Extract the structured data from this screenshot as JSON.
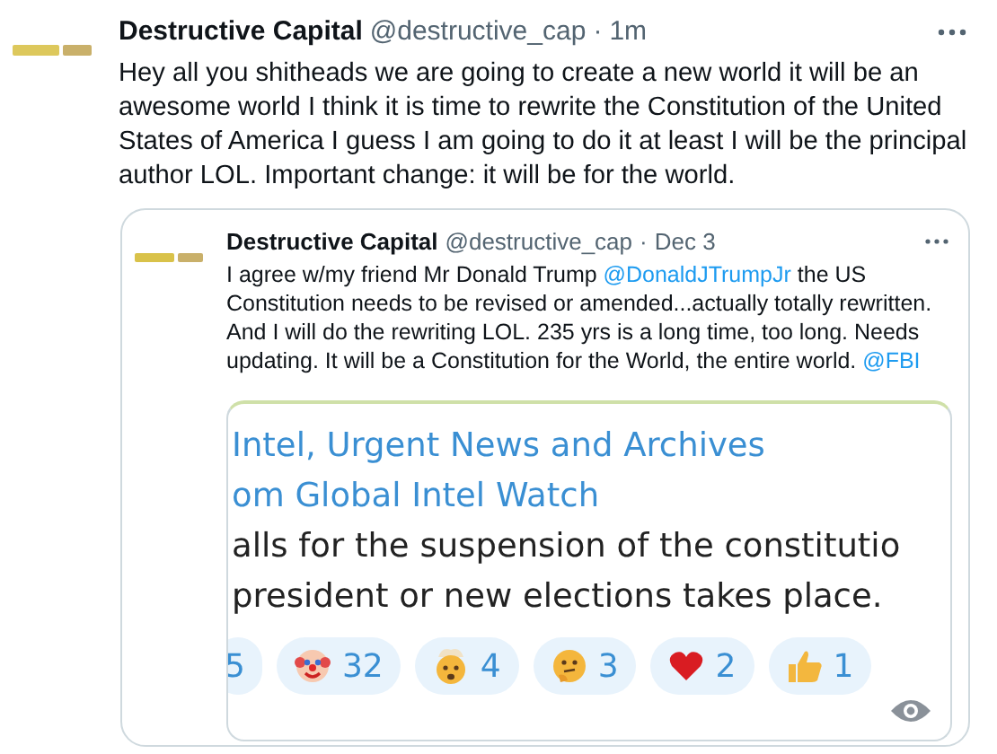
{
  "tweet": {
    "author": "Destructive Capital",
    "handle": "@destructive_cap",
    "separator": "·",
    "time": "1m",
    "text": "Hey all you shitheads we are going to create a new world it will be an awesome world I think it is time to rewrite the Constitution of the United States of America I guess I am going to do it at least I will be the principal author LOL. Important change: it will be for the world.",
    "quoted_tweet": {
      "author": "Destructive Capital",
      "handle": "@destructive_cap",
      "separator": "·",
      "time": "Dec 3",
      "text": [
        {
          "kind": "text",
          "text": "I agree w/my friend Mr Donald Trump "
        },
        {
          "kind": "mention",
          "text": "@DonaldJTrumpJr"
        },
        {
          "kind": "text",
          "text": "  the US Constitution needs to be revised or amended...actually totally rewritten. And I will do the rewriting LOL. 235 yrs is a long time, too long. Needs updating. It will be a Constitution for the World, the entire world. "
        },
        {
          "kind": "mention",
          "text": "@FBI"
        }
      ],
      "image": {
        "title_lines": [
          "Intel, Urgent News and Archives",
          "om Global Intel Watch"
        ],
        "body_lines": [
          "alls for the suspension of the constitutio",
          "president or new elections takes place."
        ],
        "reactions": [
          {
            "kind": "cut",
            "count": "5"
          },
          {
            "kind": "clown",
            "count": "32"
          },
          {
            "kind": "exploding",
            "count": "4"
          },
          {
            "kind": "thinking",
            "count": "3"
          },
          {
            "kind": "heart",
            "count": "2"
          },
          {
            "kind": "thumbs",
            "count": "1"
          }
        ]
      }
    }
  }
}
